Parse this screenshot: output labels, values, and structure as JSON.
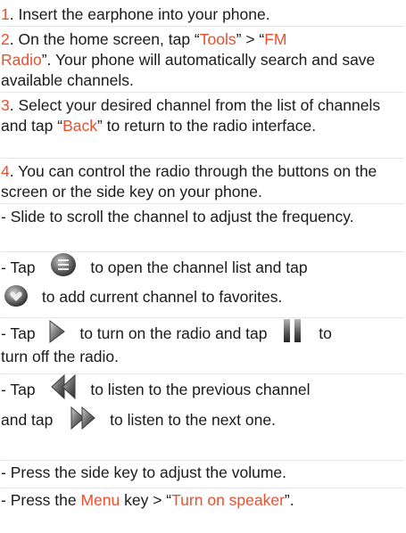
{
  "steps": [
    {
      "number": "1",
      "text": ". Insert the earphone into your phone."
    },
    {
      "number": "2",
      "t1": ". On the home screen, tap “",
      "h1": "Tools",
      "t2": "” > “",
      "h2a": "FM",
      "h2b": "Radio",
      "t3": "”. Your phone will automatically search and save available channels."
    },
    {
      "number": "3",
      "t1": ". Select your desired channel from the list of channels and tap “",
      "h1": "Back",
      "t2": "” to return to the radio interface."
    },
    {
      "number": "4",
      "text": ". You can control the radio through the buttons on the screen or the side key on your phone."
    }
  ],
  "bullets": {
    "slide": "-    Slide to scroll the channel to adjust the frequency.",
    "list_a": "-    Tap",
    "list_b": "to open the channel list and tap",
    "list_c": "to add current channel to favorites.",
    "play_a": "-    Tap",
    "play_b": "to turn on the radio and tap",
    "play_c": "to",
    "play_d": "turn off the radio.",
    "prev_a": "-    Tap",
    "prev_b": "to listen to the previous channel",
    "next_a": "and tap",
    "next_b": "to listen to the next one.",
    "volume": "-    Press the side key to adjust the volume.",
    "speaker_a": "-    Press the ",
    "speaker_menu": "Menu",
    "speaker_b": " key > “",
    "speaker_hl": "Turn on speaker",
    "speaker_c": "”."
  },
  "colors": {
    "highlight": "#e8502e",
    "text": "#1a1a1a"
  },
  "icons": {
    "channel_list": "channel-list-icon",
    "favorite": "favorite-icon",
    "play": "play-icon",
    "pause": "pause-icon",
    "previous": "previous-icon",
    "next": "next-icon"
  }
}
